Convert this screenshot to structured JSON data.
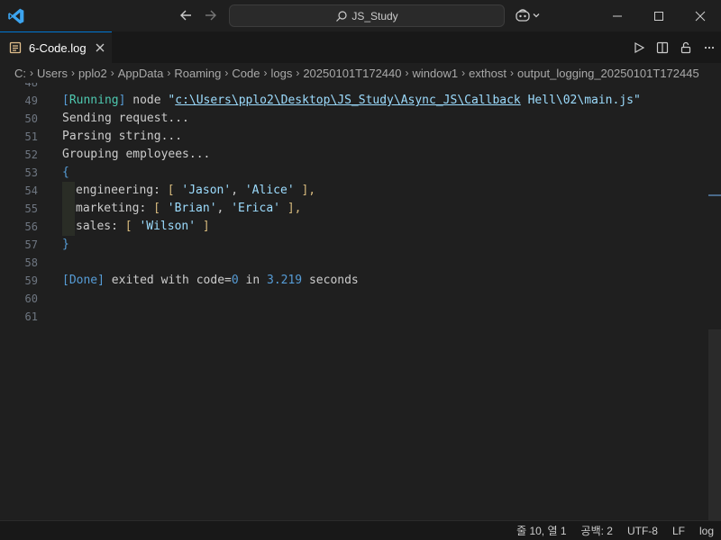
{
  "titlebar": {
    "search_text": "JS_Study",
    "icons": [
      "vscode-logo-icon",
      "arrow-left-icon",
      "arrow-right-icon",
      "search-icon",
      "copilot-icon",
      "chevron-down-icon",
      "minimize-icon",
      "maximize-icon",
      "close-icon"
    ]
  },
  "tab": {
    "label": "6-Code.log",
    "active_border_color": "#0078d4"
  },
  "breadcrumb": [
    "C:",
    "Users",
    "pplo2",
    "AppData",
    "Roaming",
    "Code",
    "logs",
    "20250101T172440",
    "window1",
    "exthost",
    "output_logging_20250101T172445"
  ],
  "editor": {
    "partial_top_line_number": "48",
    "line_numbers": [
      "49",
      "50",
      "51",
      "52",
      "53",
      "54",
      "55",
      "56",
      "57",
      "58",
      "59",
      "60",
      "61"
    ],
    "lines": {
      "l49": {
        "bracket_open": "[",
        "running": "Running",
        "bracket_close": "]",
        "cmd": " node ",
        "quote_open": "\"",
        "path": "c:\\Users\\pplo2\\Desktop\\JS_Study\\Async_JS\\Callback",
        "path_rest": " Hell\\02\\main.js",
        "quote_close": "\""
      },
      "l50": "Sending request...",
      "l51": "Parsing string...",
      "l52": "Grouping employees...",
      "l53": "{",
      "l54": {
        "key": "engineering: ",
        "open": "[ ",
        "v1": "'Jason'",
        "sep": ", ",
        "v2": "'Alice'",
        "close": " ],"
      },
      "l55": {
        "key": "marketing: ",
        "open": "[ ",
        "v1": "'Brian'",
        "sep": ", ",
        "v2": "'Erica'",
        "close": " ],"
      },
      "l56": {
        "key": "sales: ",
        "open": "[ ",
        "v1": "'Wilson'",
        "close": " ]"
      },
      "l57": "}",
      "l59": {
        "bracket_open": "[",
        "done": "Done",
        "bracket_close": "]",
        "text1": " exited with code=",
        "code": "0",
        "text2": " in ",
        "seconds": "3.219",
        "text3": " seconds"
      }
    }
  },
  "statusbar": {
    "position": "줄 10, 열 1",
    "spaces": "공백: 2",
    "encoding": "UTF-8",
    "eol": "LF",
    "language": "log"
  }
}
